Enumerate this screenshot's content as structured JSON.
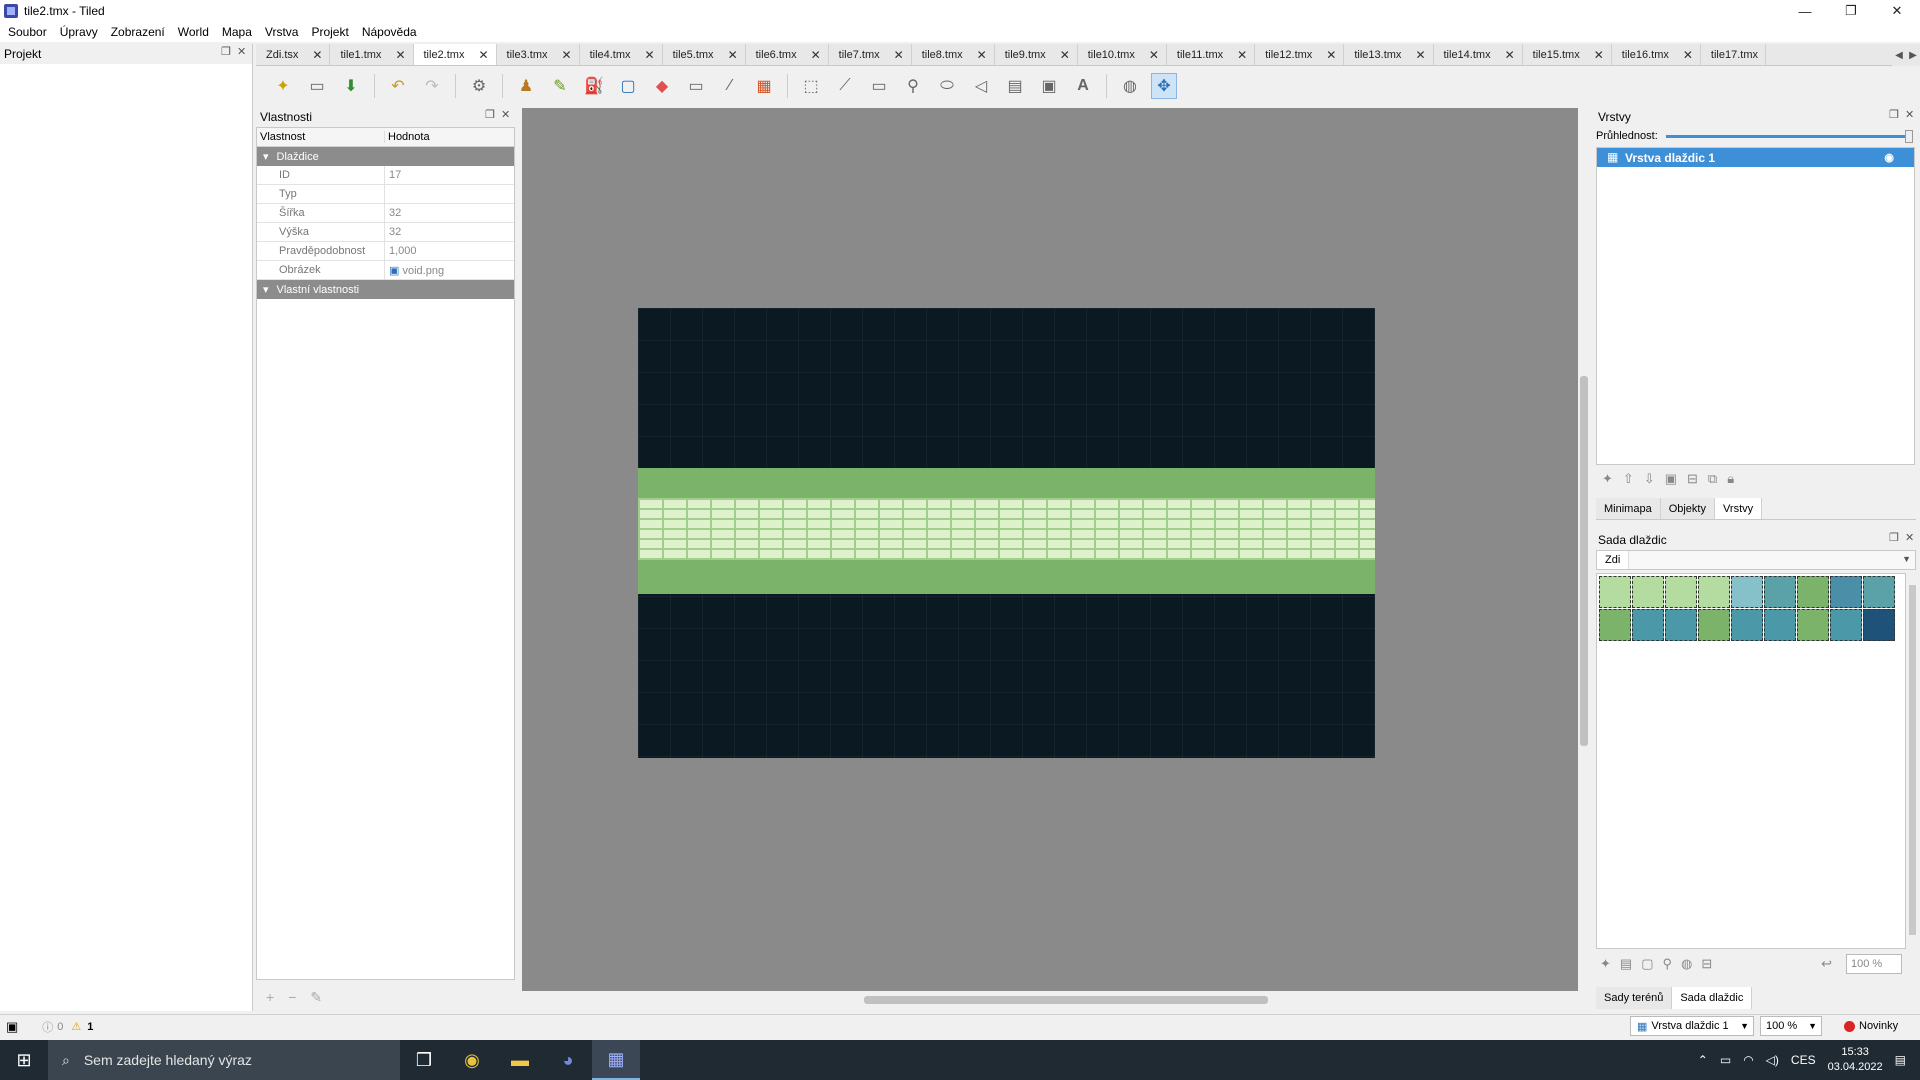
{
  "window": {
    "title": "tile2.tmx - Tiled",
    "min": "—",
    "max": "❐",
    "close": "✕"
  },
  "menu": [
    "Soubor",
    "Úpravy",
    "Zobrazení",
    "World",
    "Mapa",
    "Vrstva",
    "Projekt",
    "Nápověda"
  ],
  "projekt_panel": {
    "title": "Projekt"
  },
  "tabs": [
    "Zdi.tsx",
    "tile1.tmx",
    "tile2.tmx",
    "tile3.tmx",
    "tile4.tmx",
    "tile5.tmx",
    "tile6.tmx",
    "tile7.tmx",
    "tile8.tmx",
    "tile9.tmx",
    "tile10.tmx",
    "tile11.tmx",
    "tile12.tmx",
    "tile13.tmx",
    "tile14.tmx",
    "tile15.tmx",
    "tile16.tmx",
    "tile17.tmx"
  ],
  "active_tab": "tile2.tmx",
  "properties": {
    "title": "Vlastnosti",
    "col_key": "Vlastnost",
    "col_value": "Hodnota",
    "group1": "Dlaždice",
    "rows": [
      {
        "k": "ID",
        "v": "17"
      },
      {
        "k": "Typ",
        "v": ""
      },
      {
        "k": "Šířka",
        "v": "32"
      },
      {
        "k": "Výška",
        "v": "32"
      },
      {
        "k": "Pravděpodobnost",
        "v": "1,000"
      },
      {
        "k": "Obrázek",
        "v": "void.png"
      }
    ],
    "group2": "Vlastní vlastnosti"
  },
  "layers": {
    "title": "Vrstvy",
    "opacity_label": "Průhlednost:",
    "opacity": 1.0,
    "items": [
      "Vrstva dlaždic 1"
    ]
  },
  "subtabs": [
    "Minimapa",
    "Objekty",
    "Vrstvy"
  ],
  "tileset": {
    "title": "Sada dlaždic",
    "selected": "Zdi",
    "zoom": "100 %"
  },
  "bottom_tabs": [
    "Sady terénů",
    "Sada dlaždic"
  ],
  "status": {
    "errors": "0",
    "warnings": "1",
    "layer": "Vrstva dlaždic 1",
    "zoom": "100 %",
    "news": "Novinky"
  },
  "taskbar": {
    "search_placeholder": "Sem zadejte hledaný výraz",
    "lang": "CES",
    "time": "15:33",
    "date": "03.04.2022"
  },
  "colors": {
    "accent": "#3d8fd8",
    "map_bg": "#0b1a22",
    "wall_green": "#7cb36a",
    "canvas_bg": "#8a8a8a"
  }
}
